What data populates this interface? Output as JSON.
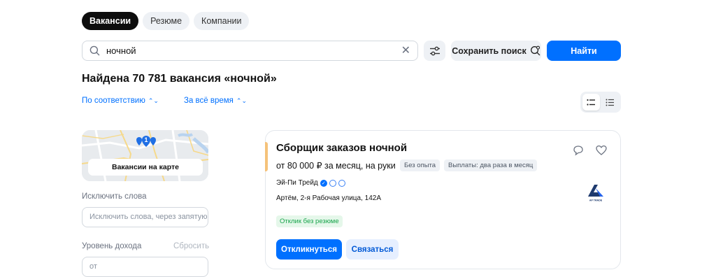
{
  "tabs": [
    {
      "label": "Вакансии",
      "active": true
    },
    {
      "label": "Резюме",
      "active": false
    },
    {
      "label": "Компании",
      "active": false
    }
  ],
  "search": {
    "value": "ночной",
    "icon": "search-icon",
    "clear_icon": "close-icon"
  },
  "toolbar": {
    "filters_icon": "filters-icon",
    "save_search_label": "Сохранить поиск",
    "save_search_icon": "bell-search-icon",
    "find_label": "Найти"
  },
  "results": {
    "headline": "Найдена 70 781 вакансия «ночной»",
    "sort_relevance": "По соответствию",
    "sort_period": "За всё время"
  },
  "view_toggle": {
    "list_icon": "list-view-icon",
    "compact_icon": "compact-view-icon",
    "active": "list"
  },
  "sidebar": {
    "map_label": "Вакансии на карте",
    "map_pin_count": "1",
    "exclude_label": "Исключить слова",
    "exclude_placeholder": "Исключить слова, через запятую",
    "income_label": "Уровень дохода",
    "income_reset": "Сбросить",
    "income_from_placeholder": "от"
  },
  "vacancy": {
    "title": "Сборщик заказов ночной",
    "salary": "от 80 000 ₽ за месяц, на руки",
    "chips": [
      "Без опыта",
      "Выплаты: два раза в месяц"
    ],
    "company": "Эй-Пи Трейд",
    "address": "Артём, 2-я Рабочая улица, 142А",
    "no_resume_badge": "Отклик без резюме",
    "apply_label": "Откликнуться",
    "contact_label": "Связаться",
    "logo_text": "AP TRADE"
  },
  "colors": {
    "accent_blue": "#0070ff",
    "tab_active_bg": "#0d0d0d",
    "chip_bg": "#eef1f5",
    "success_green": "#16a34a",
    "card_marker": "#f5c27a"
  }
}
